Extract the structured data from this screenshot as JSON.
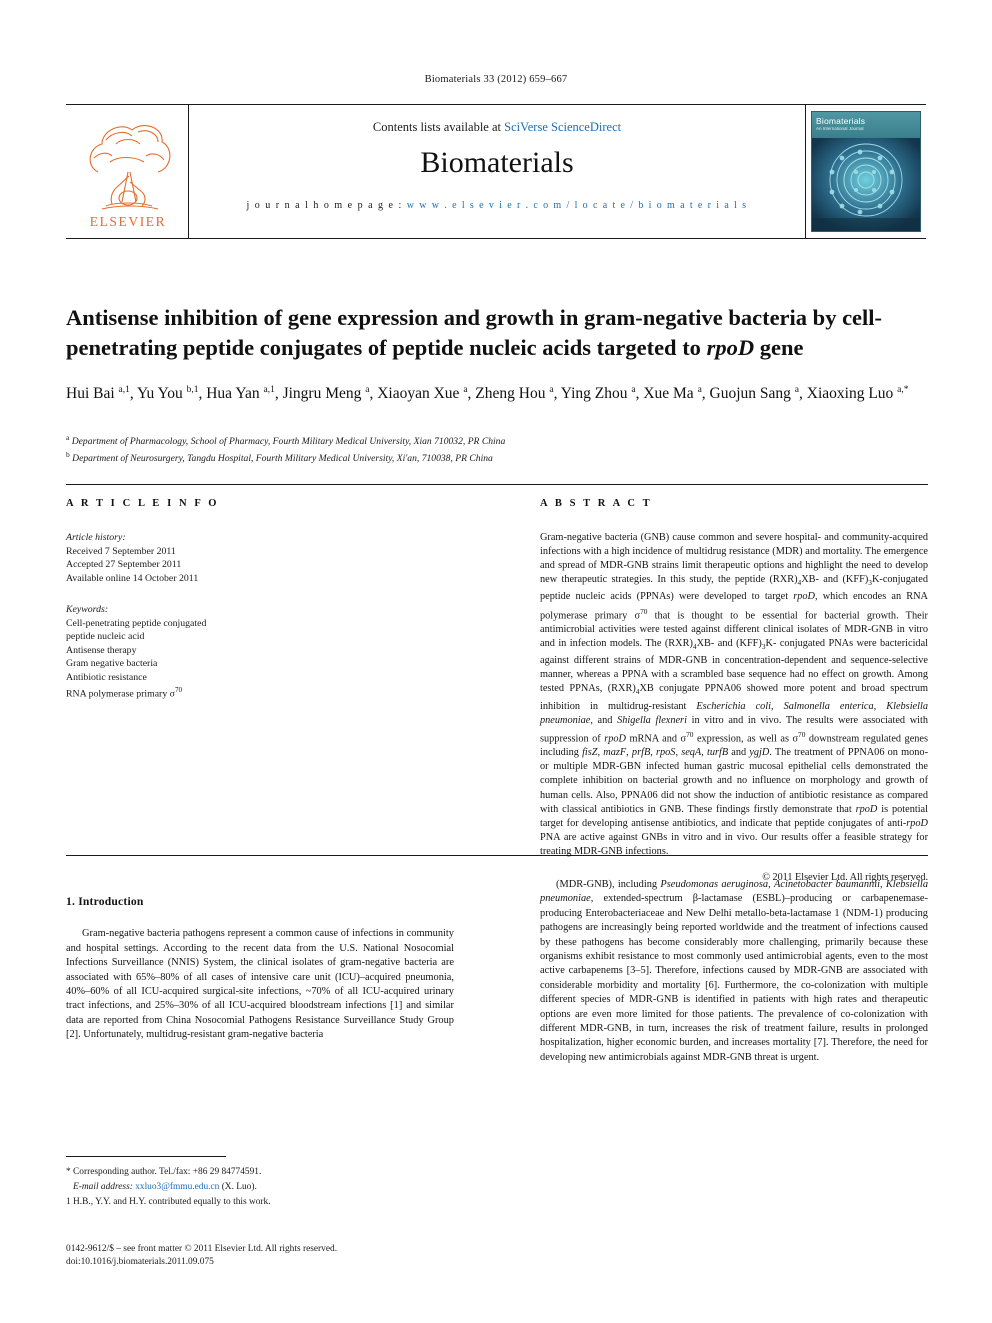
{
  "running_head": "Biomaterials 33 (2012) 659–667",
  "masthead": {
    "contents_prefix": "Contents lists available at ",
    "contents_link": "SciVerse ScienceDirect",
    "journal_title": "Biomaterials",
    "homepage_prefix": "j o u r n a l   h o m e p a g e :   ",
    "homepage_url": "w w w . e l s e v i e r . c o m / l o c a t e / b i o m a t e r i a l s",
    "publisher": "ELSEVIER",
    "cover": {
      "title": "Biomaterials",
      "subtitle": "An International Journal"
    },
    "accent_blue": "#1f6fb2",
    "elsevier_orange": "#E36C2E"
  },
  "article": {
    "title_part1": "Antisense inhibition of gene expression and growth in gram-negative bacteria by cell-penetrating peptide conjugates of peptide nucleic acids targeted to ",
    "title_italic": "rpoD",
    "title_part2": " gene",
    "authors": "Hui Bai a,1, Yu You b,1, Hua Yan a,1, Jingru Meng a, Xiaoyan Xue a, Zheng Hou a, Ying Zhou a, Xue Ma a, Guojun Sang a, Xiaoxing Luo a,*",
    "affiliation_a": "Department of Pharmacology, School of Pharmacy, Fourth Military Medical University, Xian 710032, PR China",
    "affiliation_b": "Department of Neurosurgery, Tangdu Hospital, Fourth Military Medical University, Xi'an, 710038, PR China"
  },
  "article_info": {
    "heading": "A R T I C L E   I N F O",
    "history_label": "Article history:",
    "history": [
      "Received 7 September 2011",
      "Accepted 27 September 2011",
      "Available online 14 October 2011"
    ],
    "keywords_label": "Keywords:",
    "keywords": [
      "Cell-penetrating peptide conjugated",
      "peptide nucleic acid",
      "Antisense therapy",
      "Gram negative bacteria",
      "Antibiotic resistance",
      "RNA polymerase primary σ70"
    ]
  },
  "abstract": {
    "heading": "A B S T R A C T",
    "text": "Gram-negative bacteria (GNB) cause common and severe hospital- and community-acquired infections with a high incidence of multidrug resistance (MDR) and mortality. The emergence and spread of MDR-GNB strains limit therapeutic options and highlight the need to develop new therapeutic strategies. In this study, the peptide (RXR)4XB- and (KFF)3K-conjugated peptide nucleic acids (PPNAs) were developed to target rpoD, which encodes an RNA polymerase primary σ70 that is thought to be essential for bacterial growth. Their antimicrobial activities were tested against different clinical isolates of MDR-GNB in vitro and in infection models. The (RXR)4XB- and (KFF)3K- conjugated PNAs were bactericidal against different strains of MDR-GNB in concentration-dependent and sequence-selective manner, whereas a PPNA with a scrambled base sequence had no effect on growth. Among tested PPNAs, (RXR)4XB conjugate PPNA06 showed more potent and broad spectrum inhibition in multidrug-resistant Escherichia coli, Salmonella enterica, Klebsiella pneumoniae, and Shigella flexneri in vitro and in vivo. The results were associated with suppression of rpoD mRNA and σ70 expression, as well as σ70 downstream regulated genes including fisZ, mazF, prfB, rpoS, seqA, turfB and ygjD. The treatment of PPNA06 on mono- or multiple MDR-GBN infected human gastric mucosal epithelial cells demonstrated the complete inhibition on bacterial growth and no influence on morphology and growth of human cells. Also, PPNA06 did not show the induction of antibiotic resistance as compared with classical antibiotics in GNB. These findings firstly demonstrate that rpoD is potential target for developing antisense antibiotics, and indicate that peptide conjugates of anti-rpoD PNA are active against GNBs in vitro and in vivo. Our results offer a feasible strategy for treating MDR-GNB infections.",
    "copyright": "© 2011 Elsevier Ltd. All rights reserved."
  },
  "introduction": {
    "heading": "1.  Introduction",
    "left_paragraph": "Gram-negative bacteria pathogens represent a common cause of infections in community and hospital settings. According to the recent data from the U.S. National Nosocomial Infections Surveillance (NNIS) System, the clinical isolates of gram-negative bacteria are associated with 65%–80% of all cases of intensive care unit (ICU)–acquired pneumonia, 40%–60% of all ICU-acquired surgical-site infections, ~70% of all ICU-acquired urinary tract infections, and 25%–30% of all ICU-acquired bloodstream infections [1] and similar data are reported from China Nosocomial Pathogens Resistance Surveillance Study Group [2]. Unfortunately, multidrug-resistant gram-negative bacteria",
    "right_paragraph": "(MDR-GNB), including Pseudomonas aeruginosa, Acinetobacter baumannii, Klebsiella pneumoniae, extended-spectrum β-lactamase (ESBL)–producing or carbapenemase-producing Enterobacteriaceae and New Delhi metallo-beta-lactamase 1 (NDM-1) producing pathogens are increasingly being reported worldwide and the treatment of infections caused by these pathogens has become considerably more challenging, primarily because these organisms exhibit resistance to most commonly used antimicrobial agents, even to the most active carbapenems [3–5]. Therefore, infections caused by MDR-GNB are associated with considerable morbidity and mortality [6]. Furthermore, the co-colonization with multiple different species of MDR-GNB is identified in patients with high rates and therapeutic options are even more limited for those patients. The prevalence of co-colonization with different MDR-GNB, in turn, increases the risk of treatment failure, results in prolonged hospitalization, higher economic burden, and increases mortality [7]. Therefore, the need for developing new antimicrobials against MDR-GNB threat is urgent."
  },
  "footnotes": {
    "corresponding": "* Corresponding author. Tel./fax: +86 29 84774591.",
    "email_label": "E-mail address:",
    "email": "xxluo3@fmmu.edu.cn",
    "email_suffix": " (X. Luo).",
    "equal_contrib": "1  H.B., Y.Y. and H.Y. contributed equally to this work."
  },
  "colophon": {
    "line1": "0142-9612/$ – see front matter © 2011 Elsevier Ltd. All rights reserved.",
    "line2": "doi:10.1016/j.biomaterials.2011.09.075"
  }
}
